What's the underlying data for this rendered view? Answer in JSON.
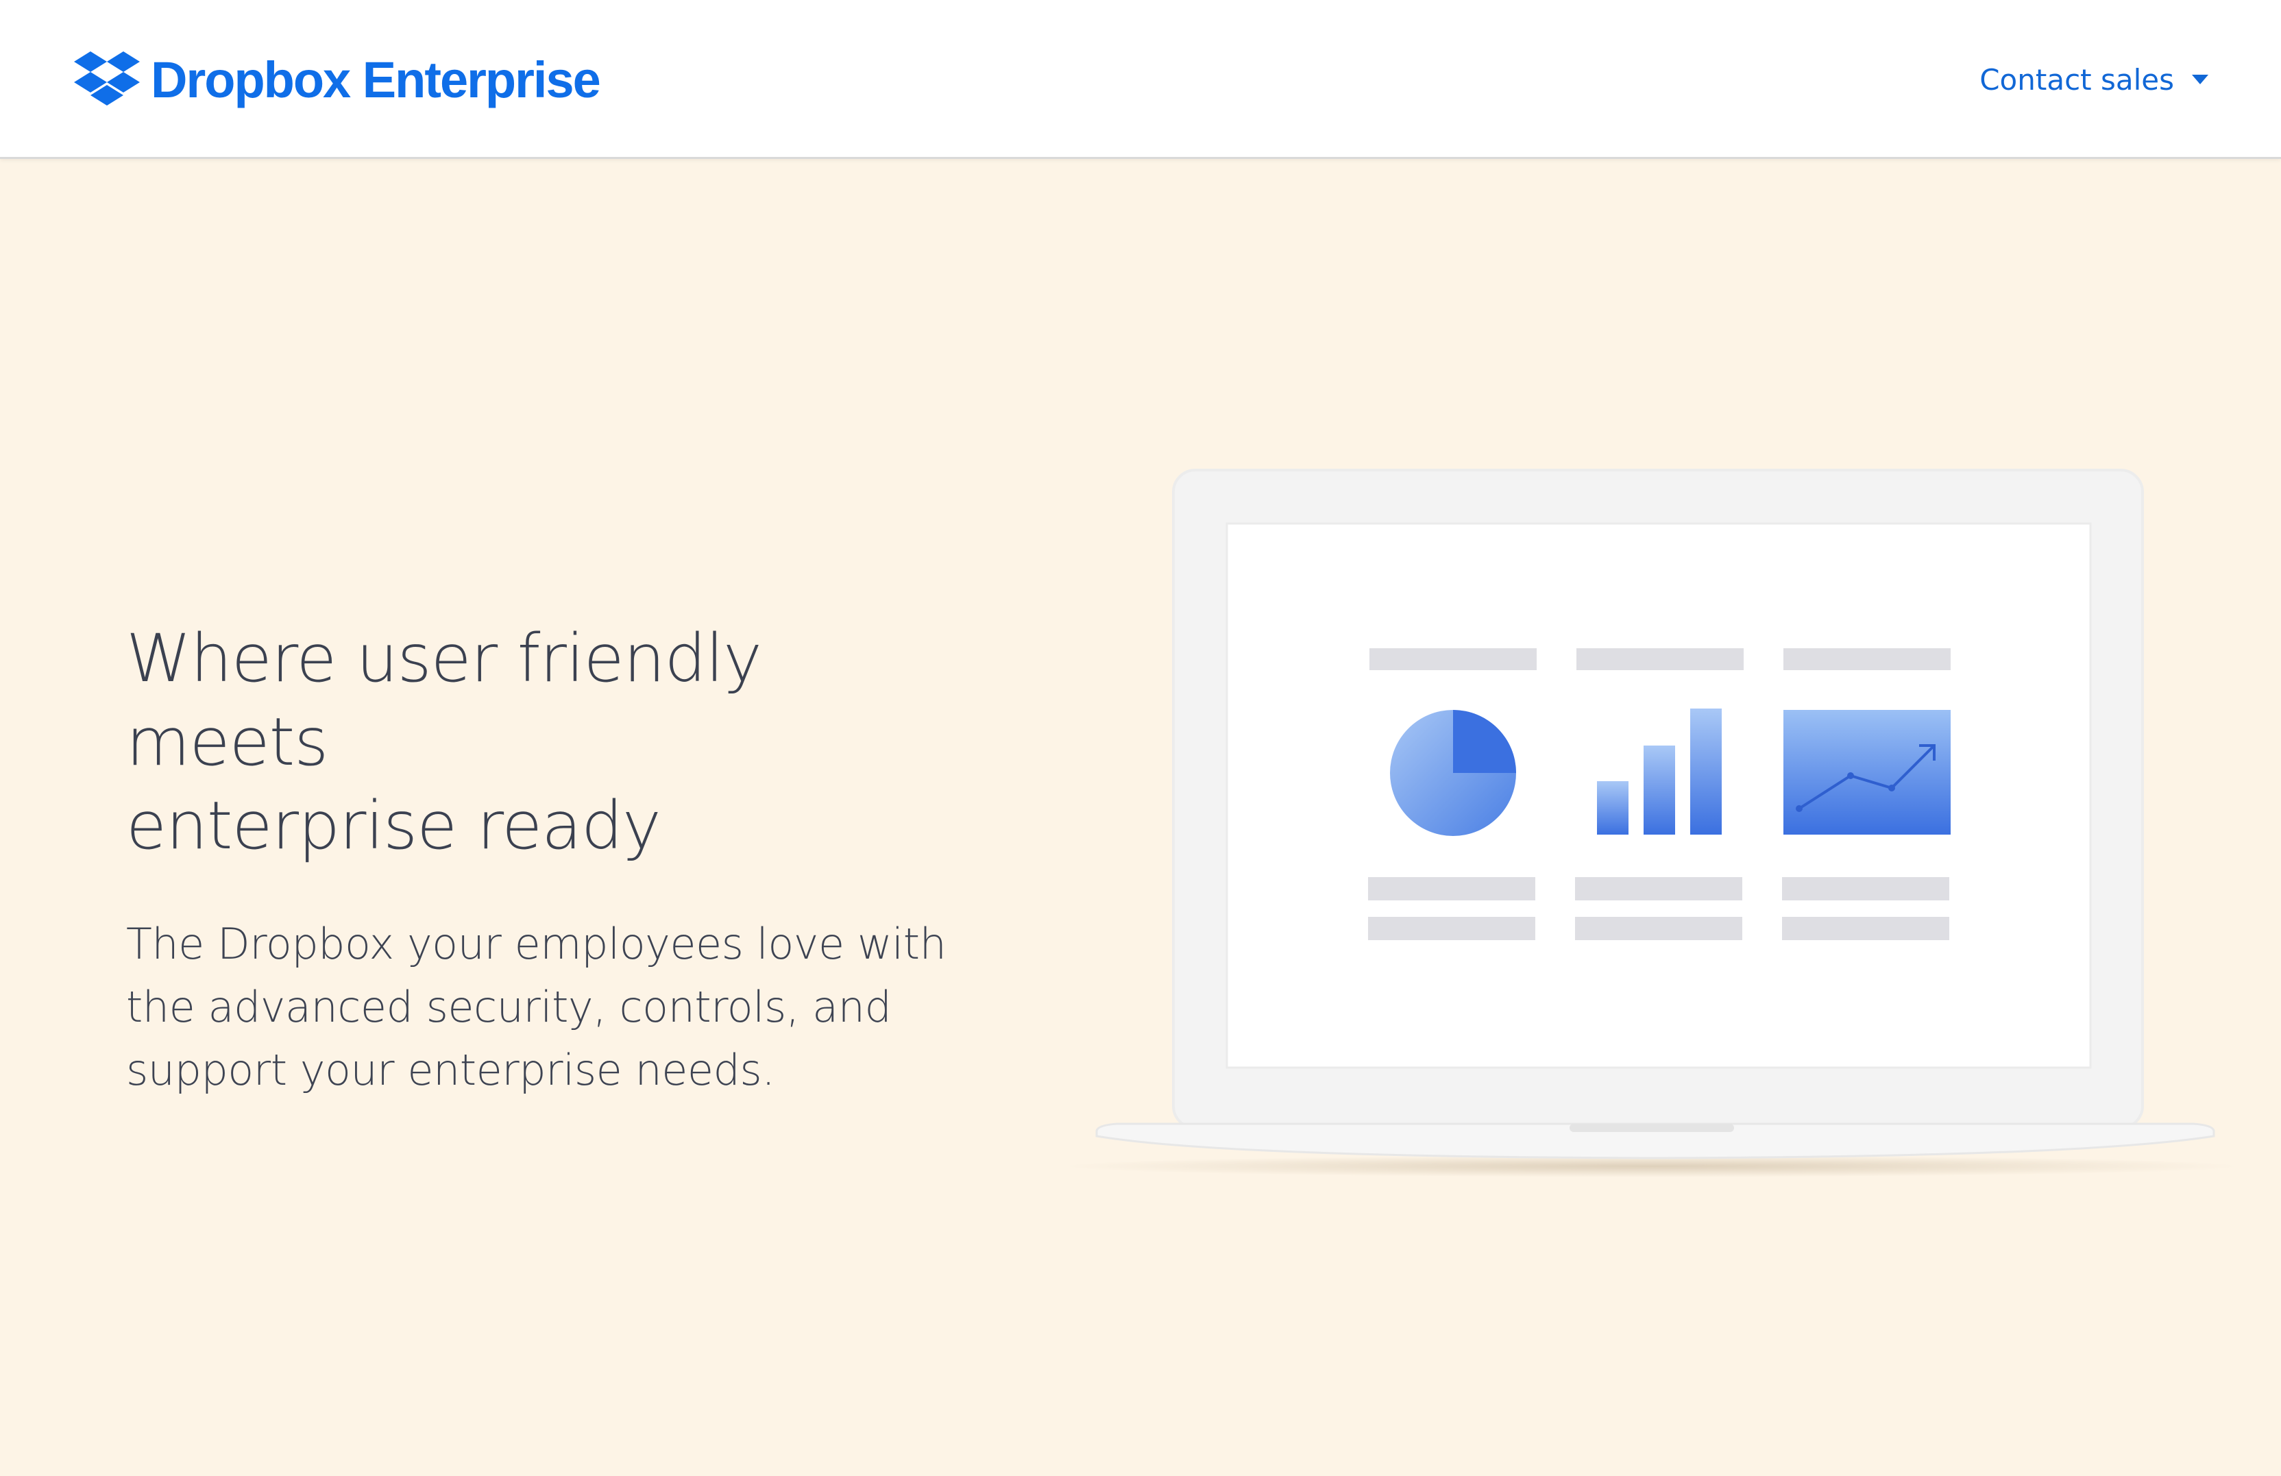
{
  "header": {
    "brand": "Dropbox Enterprise",
    "contact_label": "Contact sales"
  },
  "hero": {
    "title_line1": "Where user friendly meets",
    "title_line2": "enterprise ready",
    "subtitle_line1": "The Dropbox your employees love with",
    "subtitle_line2": "the advanced security, controls, and",
    "subtitle_line3": "support your enterprise needs."
  },
  "colors": {
    "brand_blue": "#0f6ee8",
    "link_blue": "#1167d6",
    "page_background": "#fdf4e6",
    "header_background": "#ffffff",
    "chart_blue": "#3b70e0",
    "placeholder_gray": "#dedee3"
  },
  "icons": {
    "logo": "dropbox-box-icon",
    "contact_caret": "caret-down-icon"
  }
}
